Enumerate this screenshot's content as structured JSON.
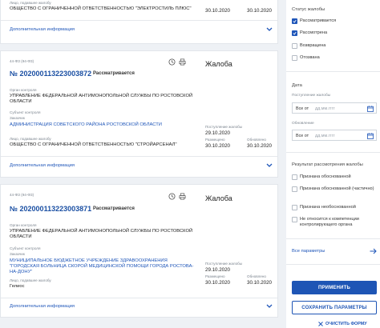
{
  "complaints": [
    {
      "applicant_label": "Лицо, подавшее жалобу",
      "applicant_value": "ОБЩЕСТВО С ОГРАНИЧЕННОЙ ОТВЕТСТВЕННОСТЬЮ \"ЭЛЕКТРОСТИЛЬ ПЛЮС\"",
      "col1_date": "30.10.2020",
      "col2_date": "30.10.2020",
      "more_label": "Дополнительная информация"
    },
    {
      "law": "44-ФЗ (94-ФЗ)",
      "number": "№ 202000113223003872",
      "status": "Рассматривается",
      "kind": "Жалоба",
      "control_label": "Орган контроля",
      "control_value": "УПРАВЛЕНИЕ ФЕДЕРАЛЬНОЙ АНТИМОНОПОЛЬНОЙ СЛУЖБЫ ПО РОСТОВСКОЙ ОБЛАСТИ",
      "subject_label": "Субъект контроля",
      "customer_label": "Заказчик",
      "customer_value": "АДМИНИСТРАЦИЯ СОВЕТСКОГО РАЙОНА РОСТОВСКОЙ ОБЛАСТИ",
      "received_label": "Поступление жалобы",
      "received_date": "29.10.2020",
      "applicant_label": "Лицо, подавшее жалобу",
      "applicant_value": "ОБЩЕСТВО С ОГРАНИЧЕННОЙ ОТВЕТСТВЕННОСТЬЮ \"СТРОЙАРСЕНАЛ\"",
      "placed_label": "Размещено",
      "placed_date": "30.10.2020",
      "updated_label": "Обновлено",
      "updated_date": "30.10.2020",
      "more_label": "Дополнительная информация"
    },
    {
      "law": "44-ФЗ (94-ФЗ)",
      "number": "№ 202000113223003871",
      "status": "Рассматривается",
      "kind": "Жалоба",
      "control_label": "Орган контроля",
      "control_value": "УПРАВЛЕНИЕ ФЕДЕРАЛЬНОЙ АНТИМОНОПОЛЬНОЙ СЛУЖБЫ ПО РОСТОВСКОЙ ОБЛАСТИ",
      "subject_label": "Субъект контроля",
      "customer_label": "Заказчик",
      "customer_value": "МУНИЦИПАЛЬНОЕ БЮДЖЕТНОЕ УЧРЕЖДЕНИЕ ЗДРАВООХРАНЕНИЯ \"ГОРОДСКАЯ БОЛЬНИЦА СКОРОЙ МЕДИЦИНСКОЙ ПОМОЩИ ГОРОДА РОСТОВА-НА-ДОНУ\"",
      "received_label": "Поступление жалобы",
      "received_date": "29.10.2020",
      "applicant_label": "Лицо, подавшее жалобу",
      "applicant_value": "Гелиос",
      "placed_label": "Размещено",
      "placed_date": "30.10.2020",
      "updated_label": "Обновлено",
      "updated_date": "30.10.2020",
      "more_label": "Дополнительная информация"
    }
  ],
  "sidebar": {
    "status_title": "Статус жалобы",
    "status_options": [
      {
        "label": "Рассматривается",
        "checked": true
      },
      {
        "label": "Рассмотрена",
        "checked": true
      },
      {
        "label": "Возвращена",
        "checked": false
      },
      {
        "label": "Отозвана",
        "checked": false
      }
    ],
    "date_title": "Дата",
    "received_label": "Поступление жалобы",
    "updated_label": "Обновление",
    "date_prefix": "Все от",
    "date_placeholder": "дд.мм.гггг",
    "result_title": "Результат рассмотрения жалобы",
    "result_options": [
      {
        "label": "Признана обоснованной",
        "checked": false
      },
      {
        "label": "Признана обоснованной (частично)",
        "checked": false
      },
      {
        "label": "Признана необоснованной",
        "checked": false
      },
      {
        "label": "Не относится к компетенции контролирующего органа",
        "checked": false
      }
    ],
    "all_params": "Все параметры",
    "apply_button": "ПРИМЕНИТЬ",
    "save_button": "СОХРАНИТЬ ПАРАМЕТРЫ",
    "clear_button": "ОЧИСТИТЬ ФОРМУ"
  },
  "colors": {
    "accent": "#1e55b5",
    "link": "#1f56b9",
    "background": "#eef1f5"
  }
}
